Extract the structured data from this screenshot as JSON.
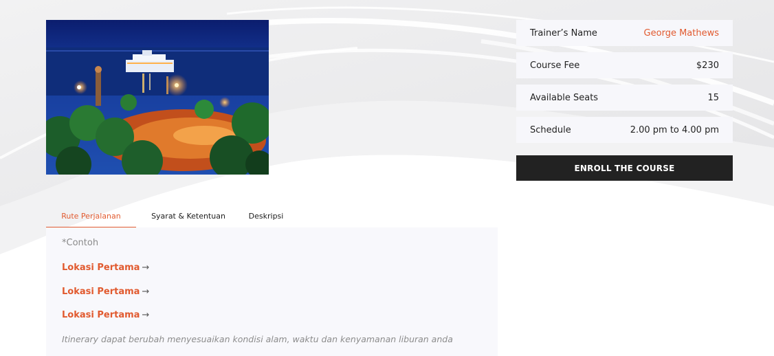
{
  "course_info": {
    "rows": [
      {
        "label": "Trainer’s Name",
        "value": "George Mathews",
        "accent": true
      },
      {
        "label": "Course Fee",
        "value": "$230",
        "accent": false
      },
      {
        "label": "Available Seats",
        "value": "15",
        "accent": false
      },
      {
        "label": "Schedule",
        "value": "2.00 pm to 4.00 pm",
        "accent": false
      }
    ],
    "enroll_label": "Enroll the Course"
  },
  "tabs": [
    {
      "label": "Rute Perjalanan",
      "active": true
    },
    {
      "label": "Syarat & Ketentuan",
      "active": false
    },
    {
      "label": "Deskripsi",
      "active": false
    }
  ],
  "itinerary": {
    "note": "*Contoh",
    "locations": [
      {
        "label": "Lokasi Pertama",
        "arrow": "→"
      },
      {
        "label": "Lokasi Pertama",
        "arrow": "→"
      },
      {
        "label": "Lokasi Pertama",
        "arrow": "→"
      }
    ],
    "footnote": "Itinerary dapat berubah menyesuaikan kondisi alam, waktu dan kenyamanan liburan anda"
  },
  "colors": {
    "accent": "#e15a2f",
    "button_bg": "#222222",
    "row_bg": "#f7f7fb"
  }
}
